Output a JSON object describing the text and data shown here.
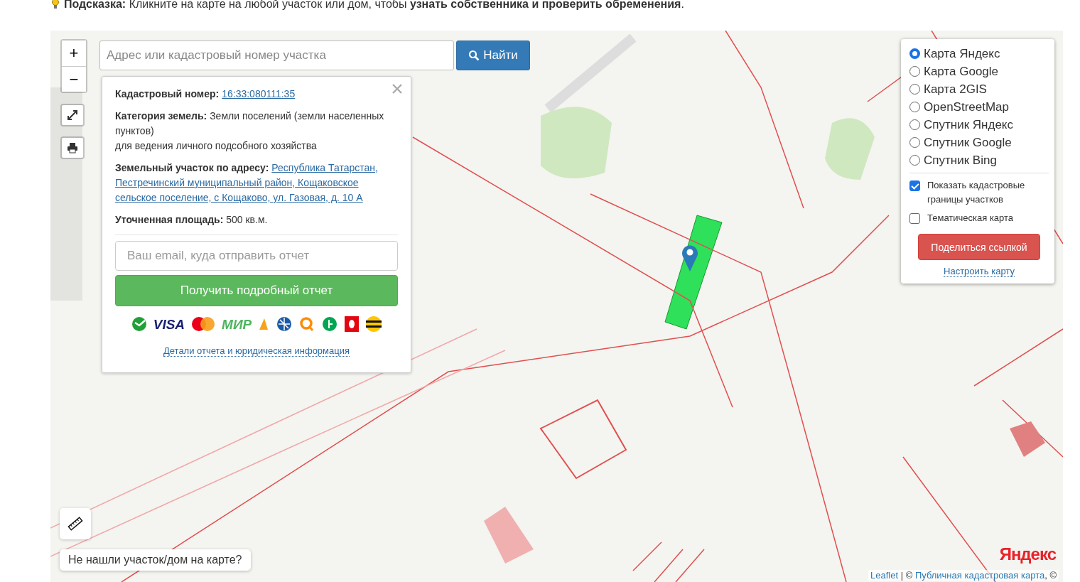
{
  "hint": {
    "text": "**Подсказка:** Кликните на карте на любой участок или дом, чтобы **узнать собственника и проверить обременения**."
  },
  "search": {
    "placeholder": "Адрес или кадастровый номер участка",
    "button": "Найти"
  },
  "zoom_controls": [
    "+",
    "−"
  ],
  "popup": {
    "rows": [
      {
        "label": "Кадастровый номер:",
        "value": "16:33:080111:35",
        "kind": "link"
      },
      {
        "label": "Категория земель:",
        "value": "Земли поселений (земли населенных пунктов)",
        "kind": "text",
        "note": "для ведения личного подсобного хозяйства"
      },
      {
        "label": "Земельный участок по адресу:",
        "value": "Республика Татарстан, Пестречинский муниципальный район, Кощаковское сельское поселение, с Кощаково, ул. Газовая, д. 10 А",
        "kind": "link"
      },
      {
        "label": "Уточненная площадь:",
        "value": "500 кв.м.",
        "kind": "text"
      }
    ],
    "email": {
      "placeholder": "Ваш email, куда отправить отчет"
    },
    "button": "Получить подробный отчет",
    "payments": [
      {
        "kind": "sber"
      },
      {
        "kind": "word",
        "text": "VISA",
        "color": "#1a1f71"
      },
      {
        "kind": "mastercard"
      },
      {
        "kind": "word",
        "text": "МИР",
        "color": "#4db45e"
      },
      {
        "kind": "yandex"
      },
      {
        "kind": "webmoney"
      },
      {
        "kind": "qiwi"
      },
      {
        "kind": "megafon"
      },
      {
        "kind": "mts"
      },
      {
        "kind": "beeline"
      }
    ],
    "details_link": "Детали отчета и юридическая информация"
  },
  "layers": {
    "base": [
      {
        "label": "Карта Яндекс",
        "selected": true
      },
      {
        "label": "Карта Google",
        "selected": false
      },
      {
        "label": "Карта 2GIS",
        "selected": false
      },
      {
        "label": "OpenStreetMap",
        "selected": false
      },
      {
        "label": "Спутник Яндекс",
        "selected": false
      },
      {
        "label": "Спутник Google",
        "selected": false
      },
      {
        "label": "Спутник Bing",
        "selected": false
      }
    ],
    "overlays": [
      {
        "label": "Показать кадастровые границы участков",
        "checked": true
      },
      {
        "label": "Тематическая карта",
        "checked": false
      }
    ],
    "share_button": "Поделиться ссылкой",
    "settings_link": "Настроить карту"
  },
  "not_found": "Не нашли участок/дом на карте?",
  "map_logo": "Яндекс",
  "attribution": {
    "leaflet": "Leaflet",
    "separator": "| ©",
    "cadastre": "Публичная кадастровая карта",
    "tail": ", ©"
  }
}
